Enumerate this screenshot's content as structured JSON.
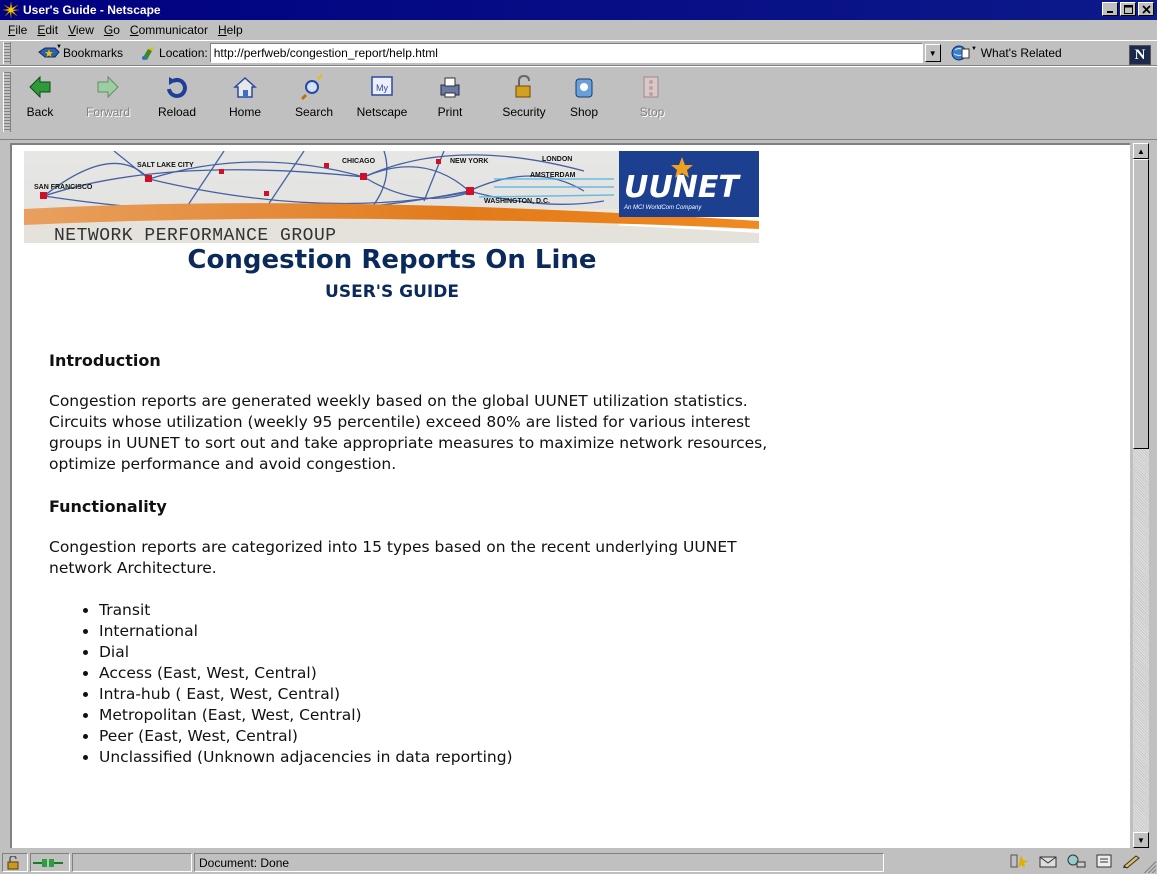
{
  "window": {
    "title": "User's Guide - Netscape",
    "app_icon": "netscape-star-icon",
    "buttons": [
      "minimize",
      "maximize",
      "close"
    ]
  },
  "menubar": {
    "items": [
      {
        "key": "F",
        "rest": "ile"
      },
      {
        "key": "E",
        "rest": "dit"
      },
      {
        "key": "V",
        "rest": "iew"
      },
      {
        "key": "G",
        "rest": "o"
      },
      {
        "key": "C",
        "rest": "ommunicator"
      },
      {
        "key": "H",
        "rest": "elp"
      }
    ]
  },
  "location_bar": {
    "bookmarks_label": "Bookmarks",
    "location_label": "Location:",
    "url": "http://perfweb/congestion_report/help.html",
    "related_label": "What's Related",
    "logo_letter": "N"
  },
  "navigation": {
    "buttons": [
      {
        "label": "Back",
        "icon": "back-arrow-icon",
        "enabled": true
      },
      {
        "label": "Forward",
        "icon": "forward-arrow-icon",
        "enabled": false
      },
      {
        "label": "Reload",
        "icon": "reload-icon",
        "enabled": true
      },
      {
        "label": "Home",
        "icon": "home-icon",
        "enabled": true
      },
      {
        "label": "Search",
        "icon": "search-icon",
        "enabled": true
      },
      {
        "label": "Netscape",
        "icon": "my-netscape-icon",
        "enabled": true
      },
      {
        "label": "Print",
        "icon": "printer-icon",
        "enabled": true
      },
      {
        "label": "Security",
        "icon": "lock-icon",
        "enabled": true
      },
      {
        "label": "Shop",
        "icon": "shop-icon",
        "enabled": true
      },
      {
        "label": "Stop",
        "icon": "stop-icon",
        "enabled": false
      }
    ]
  },
  "banner": {
    "cities": [
      "SALT LAKE CITY",
      "SAN FRANCISCO",
      "CHICAGO",
      "NEW YORK",
      "LONDON",
      "AMSTERDAM",
      "WASHINGTON, D.C."
    ],
    "brand": "UUNET",
    "brand_tagline": "An MCI WorldCom Company",
    "group": "NETWORK PERFORMANCE GROUP",
    "brand_color": "#1c3f8f"
  },
  "page": {
    "title": "Congestion Reports On Line",
    "subtitle": "USER'S GUIDE",
    "title_color": "#0b2a5c",
    "sections": {
      "intro_heading": "Introduction",
      "intro_body": "Congestion reports are generated weekly based on the global UUNET utilization statistics. Circuits whose utilization (weekly 95 percentile) exceed 80% are listed for various interest groups in UUNET to sort out and take appropriate measures to maximize network resources, optimize performance and avoid congestion.",
      "func_heading": "Functionality",
      "func_body": "Congestion reports are categorized into 15 types based on the recent underlying UUNET network Architecture.",
      "types": [
        "Transit",
        "International",
        "Dial",
        "Access (East, West, Central)",
        "Intra-hub ( East, West, Central)",
        "Metropolitan (East, West, Central)",
        "Peer (East, West, Central)",
        "Unclassified (Unknown adjacencies in data reporting)"
      ]
    }
  },
  "statusbar": {
    "text": "Document: Done"
  }
}
